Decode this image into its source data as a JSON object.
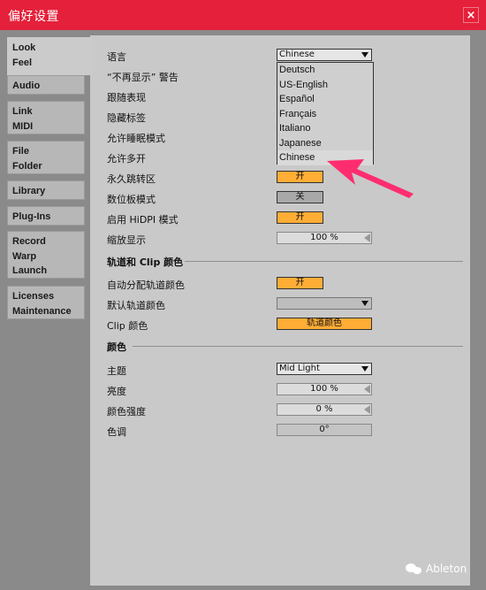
{
  "window": {
    "title": "偏好设置",
    "close_label": "×"
  },
  "sidebar": {
    "tabs": [
      {
        "lines": [
          "Look",
          "Feel"
        ],
        "active": true
      },
      {
        "lines": [
          "Audio"
        ]
      },
      {
        "lines": [
          "Link",
          "MIDI"
        ]
      },
      {
        "lines": [
          "File",
          "Folder"
        ]
      },
      {
        "lines": [
          "Library"
        ]
      },
      {
        "lines": [
          "Plug-Ins"
        ]
      },
      {
        "lines": [
          "Record",
          "Warp",
          "Launch"
        ]
      },
      {
        "lines": [
          "Licenses",
          "Maintenance"
        ]
      }
    ]
  },
  "settings": {
    "language": {
      "label": "语言",
      "value": "Chinese"
    },
    "dont_show_again": {
      "label": "“不再显示” 警告"
    },
    "follow": {
      "label": "跟随表现"
    },
    "hide_labels": {
      "label": "隐藏标签"
    },
    "allow_sleep": {
      "label": "允许睡眠模式"
    },
    "allow_multi": {
      "label": "允许多开"
    },
    "permanent_scrub": {
      "label": "永久跳转区",
      "value": "开"
    },
    "tablet_mode": {
      "label": "数位板模式",
      "value": "关"
    },
    "hidpi": {
      "label": "启用 HiDPI 模式",
      "value": "开"
    },
    "zoom": {
      "label": "缩放显示",
      "value": "100 %"
    }
  },
  "track_clip_colors": {
    "heading": "轨道和 Clip 颜色",
    "auto_assign": {
      "label": "自动分配轨道颜色",
      "value": "开"
    },
    "default_track_color": {
      "label": "默认轨道颜色",
      "value": ""
    },
    "clip_color": {
      "label": "Clip 颜色",
      "value": "轨道颜色"
    }
  },
  "colors": {
    "heading": "颜色",
    "theme": {
      "label": "主题",
      "value": "Mid Light"
    },
    "brightness": {
      "label": "亮度",
      "value": "100 %"
    },
    "intensity": {
      "label": "颜色强度",
      "value": "0 %"
    },
    "hue": {
      "label": "色调",
      "value": "0°"
    }
  },
  "language_dropdown": {
    "options": [
      "Deutsch",
      "US-English",
      "Español",
      "Français",
      "Italiano",
      "Japanese",
      "Chinese"
    ],
    "selected": "Chinese"
  },
  "watermark": {
    "text": "Ableton"
  },
  "colors_palette": {
    "titlebar": "#e5203a",
    "toggle_on": "#ffad35",
    "annotation_arrow": "#ff2d6f"
  }
}
